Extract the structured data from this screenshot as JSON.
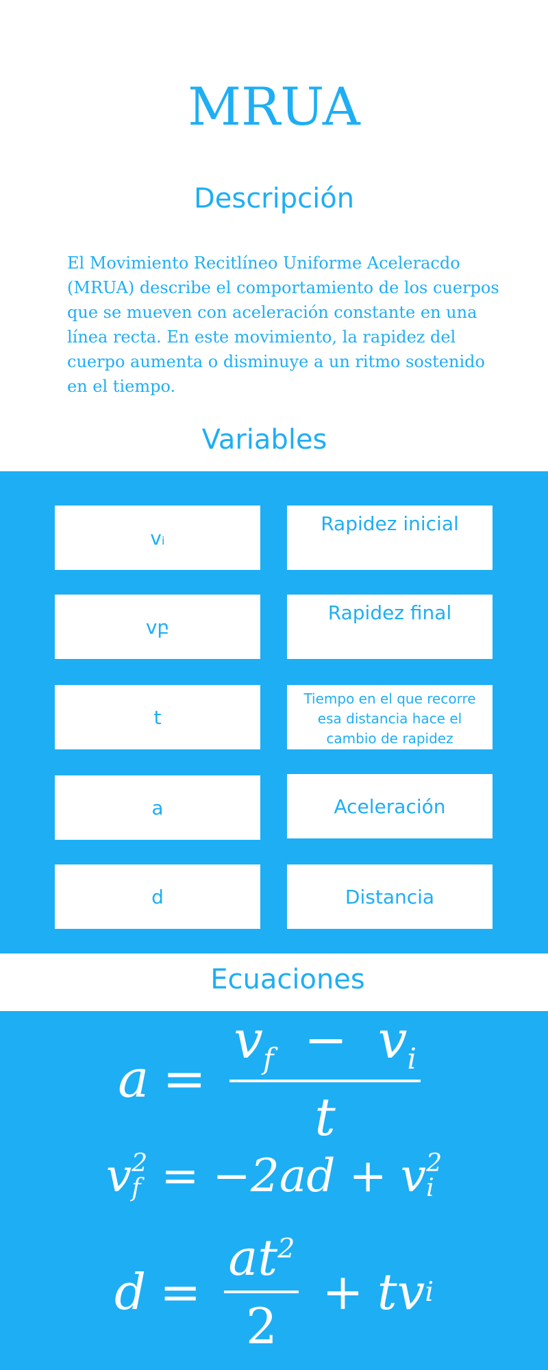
{
  "title": "MRUA",
  "description": {
    "heading": "Descripción",
    "text": "El Movimiento Recitlíneo Uniforme Aceleracdo (MRUA) describe el comportamiento de los cuerpos que se mueven con aceleración constante en una línea recta. En este movimiento, la rapidez del cuerpo aumenta o disminuye a un ritmo sostenido en el tiempo."
  },
  "variables": {
    "heading": "Variables",
    "rows": [
      {
        "symbol": "vᵢ",
        "meaning": "Rapidez inicial"
      },
      {
        "symbol": "vբ",
        "meaning": "Rapidez final"
      },
      {
        "symbol": "t",
        "meaning": "Tiempo en el que recorre esa distancia hace el cambio de rapidez"
      },
      {
        "symbol": "a",
        "meaning": "Aceleración"
      },
      {
        "symbol": "d",
        "meaning": "Distancia"
      }
    ]
  },
  "equations": {
    "heading": "Ecuaciones",
    "eq1": {
      "lhs": "a",
      "op": "=",
      "num_a": "v",
      "num_a_sub": "f",
      "num_minus": "−",
      "num_b": "v",
      "num_b_sub": "i",
      "den": "t"
    },
    "eq2": {
      "a": "v",
      "a_sub": "f",
      "a_sup": "2",
      "op": "=",
      "minus": "−",
      "b": "2ad",
      "plus": "+",
      "c": "v",
      "c_sub": "i",
      "c_sup": "2"
    },
    "eq3": {
      "lhs": "d",
      "op": "=",
      "num": "at",
      "num_sup": "2",
      "den": "2",
      "plus": "+",
      "term": "tv",
      "term_sub": "i"
    }
  },
  "colors": {
    "accent": "#1eaef4",
    "background": "#ffffff",
    "equation_text": "#ffffff"
  }
}
